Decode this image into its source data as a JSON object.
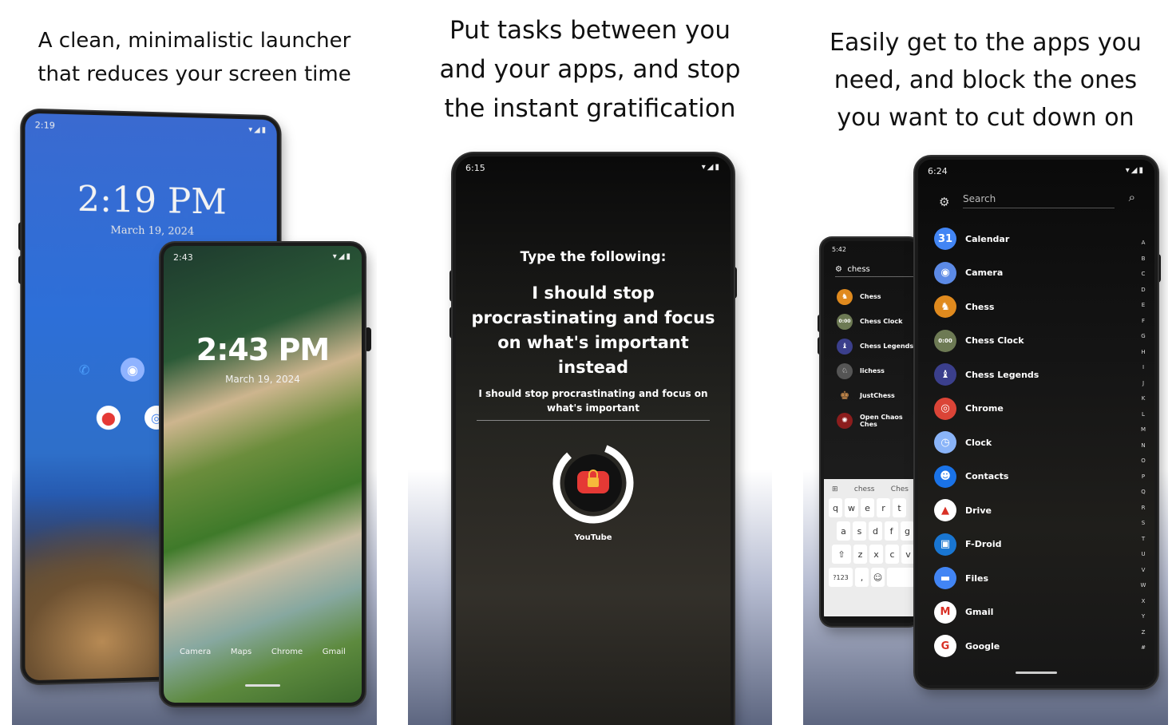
{
  "panel1": {
    "caption_lines": [
      "A clean, minimalistic launcher",
      "that reduces your screen time"
    ],
    "phone_back": {
      "status_time": "2:19",
      "clock": "2:19 PM",
      "date": "March 19, 2024"
    },
    "phone_front": {
      "status_time": "2:43",
      "clock": "2:43 PM",
      "date": "March 19, 2024",
      "dock": [
        "Camera",
        "Maps",
        "Chrome",
        "Gmail"
      ]
    }
  },
  "panel2": {
    "caption_lines": [
      "Put tasks between you",
      "and your apps, and stop",
      "the instant gratification"
    ],
    "status_time": "6:15",
    "prompt": "Type the following:",
    "phrase": "I should stop procrastinating and focus on what's important instead",
    "typed_text": "I should stop procrastinating and focus on what's important",
    "app_label": "YouTube",
    "accent": "#e53935"
  },
  "panel3": {
    "caption_lines": [
      "Easily get to the apps you",
      "need, and block the ones",
      "you want to cut down on"
    ],
    "search_phone": {
      "status_time": "5:42",
      "query": "chess",
      "results": [
        "Chess",
        "Chess Clock",
        "Chess Legends",
        "lichess",
        "JustChess",
        "Open Chaos Ches"
      ],
      "suggestions": [
        "chess",
        "Ches"
      ],
      "keyboard_rows": [
        [
          "q",
          "w",
          "e",
          "r",
          "t"
        ],
        [
          "a",
          "s",
          "d",
          "f",
          "g"
        ],
        [
          "⇧",
          "z",
          "x",
          "c",
          "v"
        ]
      ],
      "keyboard_bottom": [
        "?123",
        ",",
        "☺"
      ]
    },
    "main_phone": {
      "status_time": "6:24",
      "search_placeholder": "Search",
      "apps": [
        {
          "name": "Calendar",
          "color": "#4285f4",
          "glyph": "31"
        },
        {
          "name": "Camera",
          "color": "#5c8ae6",
          "glyph": "◉"
        },
        {
          "name": "Chess",
          "color": "#e08a1e",
          "glyph": "♞"
        },
        {
          "name": "Chess Clock",
          "color": "#6d7a54",
          "glyph": "0:00"
        },
        {
          "name": "Chess Legends",
          "color": "#3b3f8c",
          "glyph": "♝"
        },
        {
          "name": "Chrome",
          "color": "#db4437",
          "glyph": "◎"
        },
        {
          "name": "Clock",
          "color": "#8ab4f8",
          "glyph": "◷"
        },
        {
          "name": "Contacts",
          "color": "#1a73e8",
          "glyph": "☻"
        },
        {
          "name": "Drive",
          "color": "#ffffff",
          "glyph": "▲"
        },
        {
          "name": "F-Droid",
          "color": "#1976d2",
          "glyph": "▣"
        },
        {
          "name": "Files",
          "color": "#4285f4",
          "glyph": "▬"
        },
        {
          "name": "Gmail",
          "color": "#ffffff",
          "glyph": "M"
        },
        {
          "name": "Google",
          "color": "#ffffff",
          "glyph": "G"
        }
      ],
      "alphabet": [
        "A",
        "B",
        "C",
        "D",
        "E",
        "F",
        "G",
        "H",
        "I",
        "J",
        "K",
        "L",
        "M",
        "N",
        "O",
        "P",
        "Q",
        "R",
        "S",
        "T",
        "U",
        "V",
        "W",
        "X",
        "Y",
        "Z",
        "#"
      ]
    }
  }
}
